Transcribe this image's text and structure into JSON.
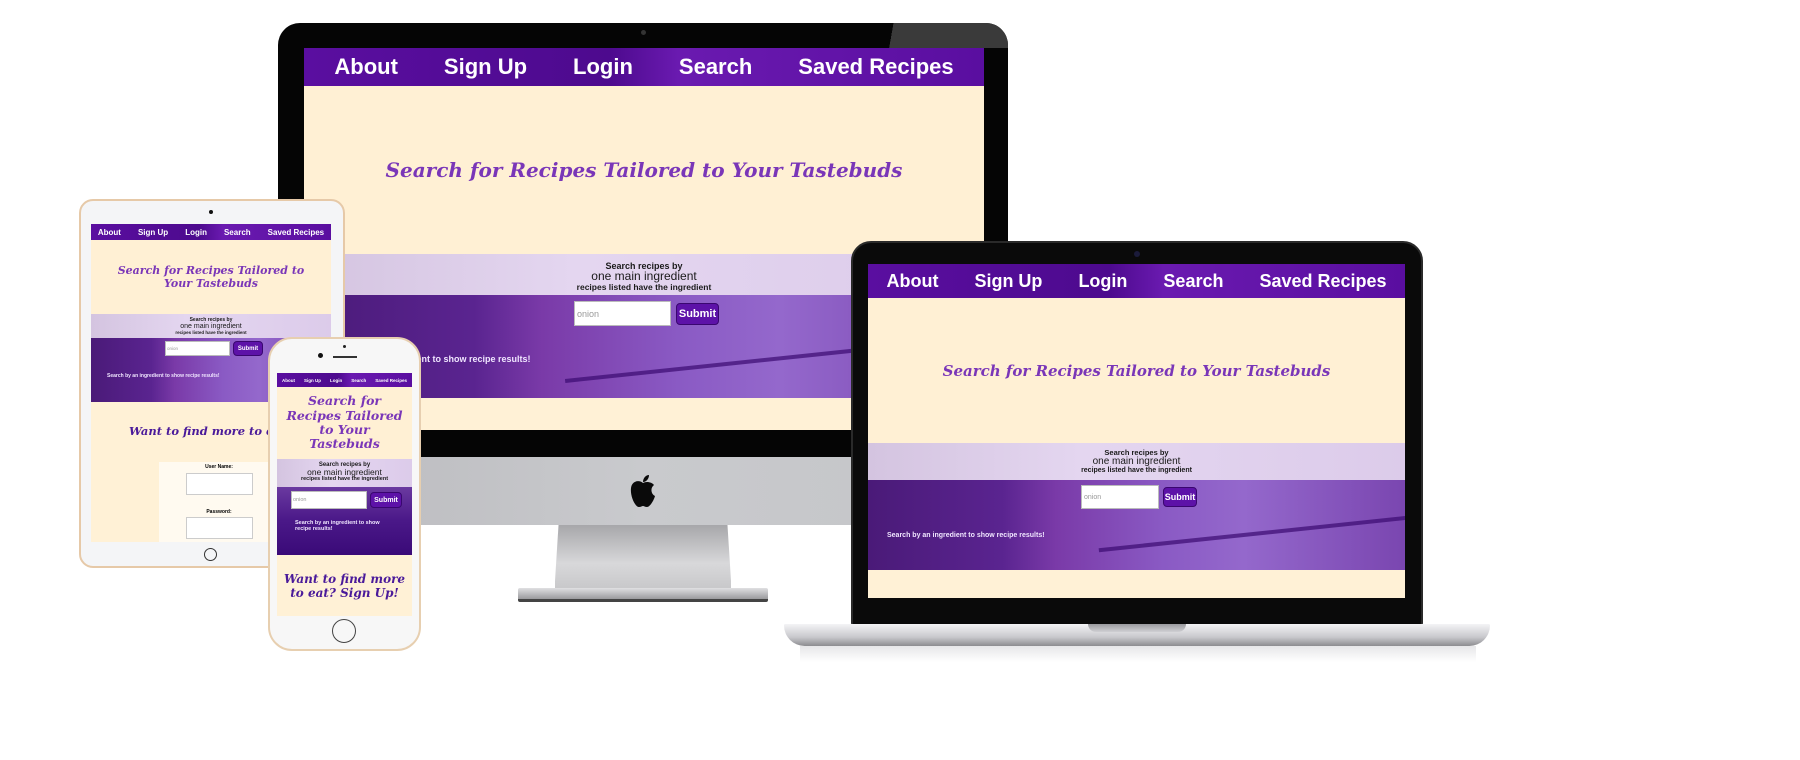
{
  "site": {
    "nav": [
      "About",
      "Sign Up",
      "Login",
      "Search",
      "Saved Recipes"
    ],
    "hero_title": "Search for Recipes Tailored to Your Tastebuds",
    "search": {
      "line1": "Search recipes by",
      "line2": "one main ingredient",
      "line3": "recipes listed have the ingredient",
      "input_placeholder": "onion",
      "submit_label": "Submit",
      "hint": "Search by an ingredient to show recipe results!"
    },
    "signup": {
      "title": "Want to find more to eat? Sign Up!",
      "title_tablet_visible": "Want to find more to eat? Sig",
      "username_label": "User Name:",
      "password_label": "Password:"
    }
  },
  "devices": [
    "desktop-monitor",
    "laptop",
    "tablet",
    "phone"
  ],
  "colors": {
    "nav_purple": "#5a0ea0",
    "hero_cream": "#fff1d6",
    "title_purple": "#7a36b8",
    "button_purple": "#5d12a8",
    "signup_title": "#4a1a9a"
  },
  "icons": {
    "brand_logo": "apple-logo-icon"
  }
}
